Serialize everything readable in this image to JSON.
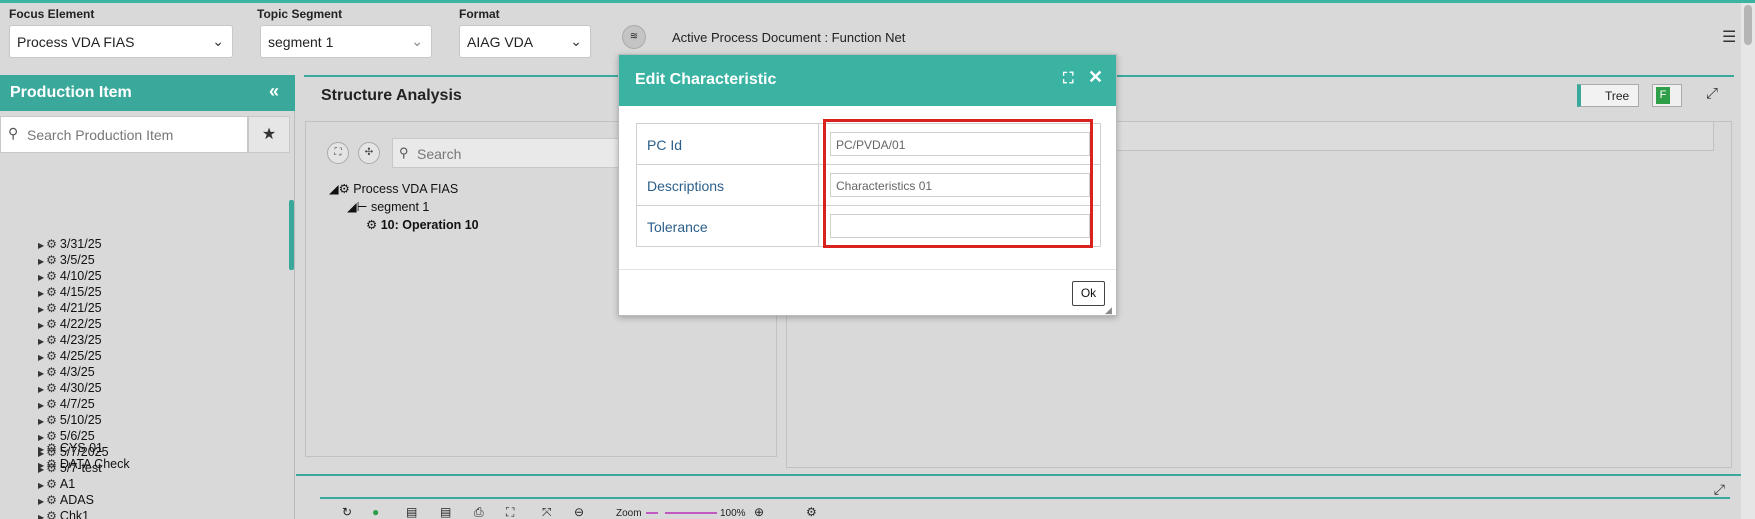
{
  "topbar": {
    "focus_label": "Focus Element",
    "focus_value": "Process VDA FIAS",
    "topic_label": "Topic Segment",
    "topic_value": "segment 1",
    "format_label": "Format",
    "format_value": "AIAG VDA",
    "active_doc": "Active Process Document : Function Net"
  },
  "left_panel": {
    "title": "Production Item",
    "search_placeholder": "Search Production Item",
    "items": [
      "3/31/25",
      "3/5/25",
      "4/10/25",
      "4/15/25",
      "4/21/25",
      "4/22/25",
      "4/23/25",
      "4/25/25",
      "4/3/25",
      "4/30/25",
      "4/7/25",
      "5/10/25",
      "5/6/25",
      "5/7/2025",
      "5/7-test",
      "A1",
      "ADAS",
      "Chk1",
      "CYS 01",
      "DATA Check"
    ]
  },
  "structure": {
    "title": "Structure Analysis",
    "search_placeholder": "Search",
    "nodes": [
      "Process VDA FIAS",
      "segment 1",
      "10: Operation 10"
    ],
    "tree_toggle": "Tree",
    "f_label": "F"
  },
  "bottom": {
    "zoom_label": "Zoom",
    "zoom_value": "100%"
  },
  "modal": {
    "title": "Edit Characteristic",
    "rows": [
      {
        "label": "PC Id",
        "value": "PC/PVDA/01"
      },
      {
        "label": "Descriptions",
        "value": "Characteristics 01"
      },
      {
        "label": "Tolerance",
        "value": ""
      }
    ],
    "ok_label": "Ok"
  },
  "colors": {
    "accent": "#3bb3a3",
    "highlight": "#d9211e",
    "label_blue": "#2b5f8a"
  }
}
